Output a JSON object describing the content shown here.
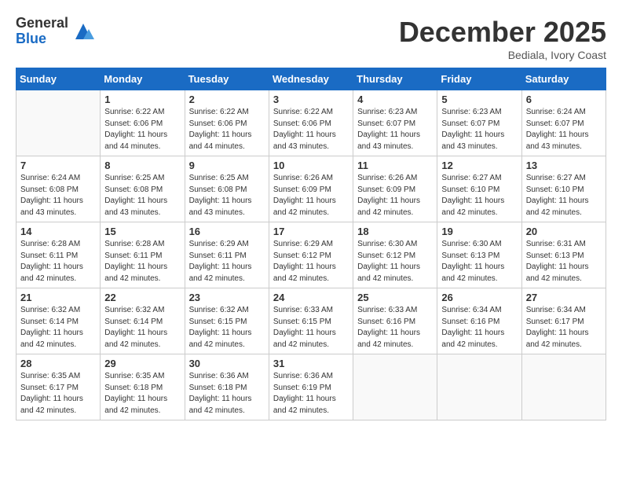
{
  "logo": {
    "general": "General",
    "blue": "Blue"
  },
  "title": "December 2025",
  "subtitle": "Bediala, Ivory Coast",
  "days": [
    "Sunday",
    "Monday",
    "Tuesday",
    "Wednesday",
    "Thursday",
    "Friday",
    "Saturday"
  ],
  "weeks": [
    [
      {
        "num": "",
        "sunrise": "",
        "sunset": "",
        "daylight": ""
      },
      {
        "num": "1",
        "sunrise": "Sunrise: 6:22 AM",
        "sunset": "Sunset: 6:06 PM",
        "daylight": "Daylight: 11 hours and 44 minutes."
      },
      {
        "num": "2",
        "sunrise": "Sunrise: 6:22 AM",
        "sunset": "Sunset: 6:06 PM",
        "daylight": "Daylight: 11 hours and 44 minutes."
      },
      {
        "num": "3",
        "sunrise": "Sunrise: 6:22 AM",
        "sunset": "Sunset: 6:06 PM",
        "daylight": "Daylight: 11 hours and 43 minutes."
      },
      {
        "num": "4",
        "sunrise": "Sunrise: 6:23 AM",
        "sunset": "Sunset: 6:07 PM",
        "daylight": "Daylight: 11 hours and 43 minutes."
      },
      {
        "num": "5",
        "sunrise": "Sunrise: 6:23 AM",
        "sunset": "Sunset: 6:07 PM",
        "daylight": "Daylight: 11 hours and 43 minutes."
      },
      {
        "num": "6",
        "sunrise": "Sunrise: 6:24 AM",
        "sunset": "Sunset: 6:07 PM",
        "daylight": "Daylight: 11 hours and 43 minutes."
      }
    ],
    [
      {
        "num": "7",
        "sunrise": "Sunrise: 6:24 AM",
        "sunset": "Sunset: 6:08 PM",
        "daylight": "Daylight: 11 hours and 43 minutes."
      },
      {
        "num": "8",
        "sunrise": "Sunrise: 6:25 AM",
        "sunset": "Sunset: 6:08 PM",
        "daylight": "Daylight: 11 hours and 43 minutes."
      },
      {
        "num": "9",
        "sunrise": "Sunrise: 6:25 AM",
        "sunset": "Sunset: 6:08 PM",
        "daylight": "Daylight: 11 hours and 43 minutes."
      },
      {
        "num": "10",
        "sunrise": "Sunrise: 6:26 AM",
        "sunset": "Sunset: 6:09 PM",
        "daylight": "Daylight: 11 hours and 42 minutes."
      },
      {
        "num": "11",
        "sunrise": "Sunrise: 6:26 AM",
        "sunset": "Sunset: 6:09 PM",
        "daylight": "Daylight: 11 hours and 42 minutes."
      },
      {
        "num": "12",
        "sunrise": "Sunrise: 6:27 AM",
        "sunset": "Sunset: 6:10 PM",
        "daylight": "Daylight: 11 hours and 42 minutes."
      },
      {
        "num": "13",
        "sunrise": "Sunrise: 6:27 AM",
        "sunset": "Sunset: 6:10 PM",
        "daylight": "Daylight: 11 hours and 42 minutes."
      }
    ],
    [
      {
        "num": "14",
        "sunrise": "Sunrise: 6:28 AM",
        "sunset": "Sunset: 6:11 PM",
        "daylight": "Daylight: 11 hours and 42 minutes."
      },
      {
        "num": "15",
        "sunrise": "Sunrise: 6:28 AM",
        "sunset": "Sunset: 6:11 PM",
        "daylight": "Daylight: 11 hours and 42 minutes."
      },
      {
        "num": "16",
        "sunrise": "Sunrise: 6:29 AM",
        "sunset": "Sunset: 6:11 PM",
        "daylight": "Daylight: 11 hours and 42 minutes."
      },
      {
        "num": "17",
        "sunrise": "Sunrise: 6:29 AM",
        "sunset": "Sunset: 6:12 PM",
        "daylight": "Daylight: 11 hours and 42 minutes."
      },
      {
        "num": "18",
        "sunrise": "Sunrise: 6:30 AM",
        "sunset": "Sunset: 6:12 PM",
        "daylight": "Daylight: 11 hours and 42 minutes."
      },
      {
        "num": "19",
        "sunrise": "Sunrise: 6:30 AM",
        "sunset": "Sunset: 6:13 PM",
        "daylight": "Daylight: 11 hours and 42 minutes."
      },
      {
        "num": "20",
        "sunrise": "Sunrise: 6:31 AM",
        "sunset": "Sunset: 6:13 PM",
        "daylight": "Daylight: 11 hours and 42 minutes."
      }
    ],
    [
      {
        "num": "21",
        "sunrise": "Sunrise: 6:32 AM",
        "sunset": "Sunset: 6:14 PM",
        "daylight": "Daylight: 11 hours and 42 minutes."
      },
      {
        "num": "22",
        "sunrise": "Sunrise: 6:32 AM",
        "sunset": "Sunset: 6:14 PM",
        "daylight": "Daylight: 11 hours and 42 minutes."
      },
      {
        "num": "23",
        "sunrise": "Sunrise: 6:32 AM",
        "sunset": "Sunset: 6:15 PM",
        "daylight": "Daylight: 11 hours and 42 minutes."
      },
      {
        "num": "24",
        "sunrise": "Sunrise: 6:33 AM",
        "sunset": "Sunset: 6:15 PM",
        "daylight": "Daylight: 11 hours and 42 minutes."
      },
      {
        "num": "25",
        "sunrise": "Sunrise: 6:33 AM",
        "sunset": "Sunset: 6:16 PM",
        "daylight": "Daylight: 11 hours and 42 minutes."
      },
      {
        "num": "26",
        "sunrise": "Sunrise: 6:34 AM",
        "sunset": "Sunset: 6:16 PM",
        "daylight": "Daylight: 11 hours and 42 minutes."
      },
      {
        "num": "27",
        "sunrise": "Sunrise: 6:34 AM",
        "sunset": "Sunset: 6:17 PM",
        "daylight": "Daylight: 11 hours and 42 minutes."
      }
    ],
    [
      {
        "num": "28",
        "sunrise": "Sunrise: 6:35 AM",
        "sunset": "Sunset: 6:17 PM",
        "daylight": "Daylight: 11 hours and 42 minutes."
      },
      {
        "num": "29",
        "sunrise": "Sunrise: 6:35 AM",
        "sunset": "Sunset: 6:18 PM",
        "daylight": "Daylight: 11 hours and 42 minutes."
      },
      {
        "num": "30",
        "sunrise": "Sunrise: 6:36 AM",
        "sunset": "Sunset: 6:18 PM",
        "daylight": "Daylight: 11 hours and 42 minutes."
      },
      {
        "num": "31",
        "sunrise": "Sunrise: 6:36 AM",
        "sunset": "Sunset: 6:19 PM",
        "daylight": "Daylight: 11 hours and 42 minutes."
      },
      {
        "num": "",
        "sunrise": "",
        "sunset": "",
        "daylight": ""
      },
      {
        "num": "",
        "sunrise": "",
        "sunset": "",
        "daylight": ""
      },
      {
        "num": "",
        "sunrise": "",
        "sunset": "",
        "daylight": ""
      }
    ]
  ]
}
